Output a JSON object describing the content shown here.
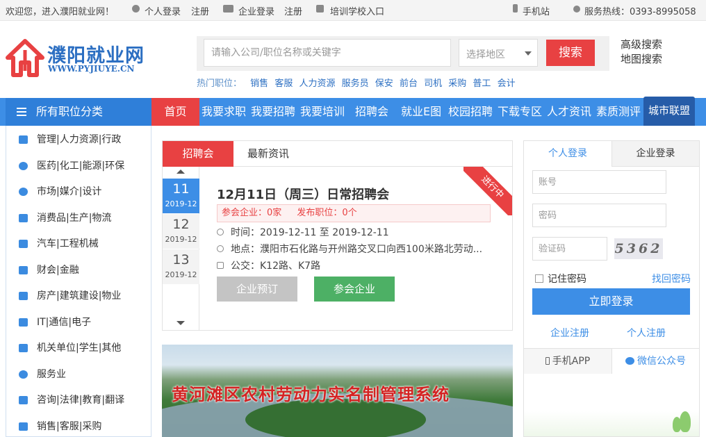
{
  "topbar": {
    "welcome": "欢迎您，进入濮阳就业网！",
    "personal_login": "个人登录",
    "personal_register": "注册",
    "company_login": "企业登录",
    "company_register": "注册",
    "training_entry": "培训学校入口",
    "mobile_site": "手机站",
    "hotline": "服务热线：0393-8995058"
  },
  "logo": {
    "name": "濮阳就业网",
    "url": "WWW.PYJIUYE.CN"
  },
  "search": {
    "placeholder": "请输入公司/职位名称或关键字",
    "area_placeholder": "选择地区",
    "button": "搜索",
    "advanced": "高级搜索",
    "map": "地图搜索"
  },
  "hot_jobs": {
    "label": "热门职位：",
    "items": [
      "销售",
      "客服",
      "人力资源",
      "服务员",
      "保安",
      "前台",
      "司机",
      "采购",
      "普工",
      "会计"
    ]
  },
  "nav": {
    "all_categories": "所有职位分类",
    "items": [
      "首页",
      "我要求职",
      "我要招聘",
      "我要培训",
      "招聘会",
      "就业E图",
      "校园招聘",
      "下载专区",
      "人才资讯",
      "素质测评"
    ],
    "city_alliance": "城市联盟"
  },
  "categories": [
    {
      "label": "管理|人力资源|行政",
      "icon": "briefcase-icon"
    },
    {
      "label": "医药|化工|能源|环保",
      "icon": "heart-pulse-icon"
    },
    {
      "label": "市场|媒介|设计",
      "icon": "pie-chart-icon"
    },
    {
      "label": "消费品|生产|物流",
      "icon": "truck-icon"
    },
    {
      "label": "汽车|工程机械",
      "icon": "car-icon"
    },
    {
      "label": "财会|金融",
      "icon": "money-icon"
    },
    {
      "label": "房产|建筑建设|物业",
      "icon": "building-icon"
    },
    {
      "label": "IT|通信|电子",
      "icon": "keyboard-icon"
    },
    {
      "label": "机关单位|学生|其他",
      "icon": "bank-icon"
    },
    {
      "label": "服务业",
      "icon": "smile-icon"
    },
    {
      "label": "咨询|法律|教育|翻译",
      "icon": "graduation-cap-icon"
    },
    {
      "label": "销售|客服|采购",
      "icon": "cart-icon"
    }
  ],
  "events": {
    "tabs": [
      "招聘会",
      "最新资讯"
    ],
    "dates": [
      {
        "day": "11",
        "month": "2019-12"
      },
      {
        "day": "12",
        "month": "2019-12"
      },
      {
        "day": "13",
        "month": "2019-12"
      }
    ],
    "badge": "进行中",
    "title": "12月11日（周三）日常招聘会",
    "companies": "参会企业：0家",
    "positions": "发布职位：0个",
    "time": "时间：2019-12-11 至 2019-12-11",
    "location": "地点：濮阳市石化路与开州路交叉口向西100米路北劳动...",
    "bus": "公交：K12路、K7路",
    "book_button": "企业预订",
    "join_button": "参会企业"
  },
  "banner": {
    "text": "黄河滩区农村劳动力实名制管理系统"
  },
  "login": {
    "tab_personal": "个人登录",
    "tab_company": "企业登录",
    "account_placeholder": "账号",
    "password_placeholder": "密码",
    "captcha_placeholder": "验证码",
    "captcha_text": "5362",
    "remember": "记住密码",
    "forgot": "找回密码",
    "submit": "立即登录",
    "company_register": "企业注册",
    "personal_register": "个人注册"
  },
  "apps": {
    "mobile_app": "手机APP",
    "wechat": "微信公众号"
  },
  "colors": {
    "brand_blue": "#3d8ee6",
    "brand_red": "#e84142",
    "green": "#4db065"
  }
}
